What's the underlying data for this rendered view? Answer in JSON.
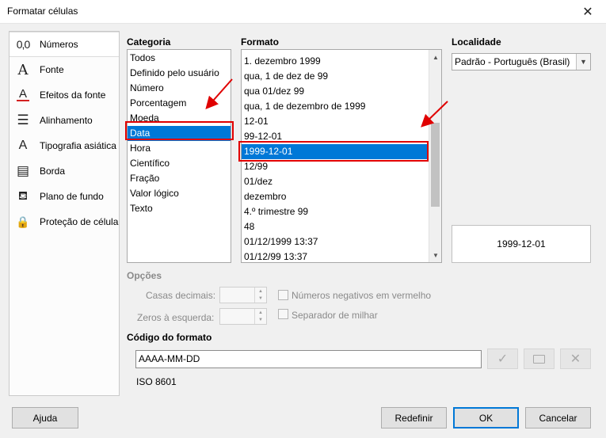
{
  "window": {
    "title": "Formatar células"
  },
  "sidebar": {
    "items": [
      {
        "label": "Números",
        "icon": "number-format-icon",
        "glyph": "0,0"
      },
      {
        "label": "Fonte",
        "icon": "font-icon",
        "glyph": "A"
      },
      {
        "label": "Efeitos da fonte",
        "icon": "font-effects-icon",
        "glyph": "A"
      },
      {
        "label": "Alinhamento",
        "icon": "alignment-icon",
        "glyph": "☰"
      },
      {
        "label": "Tipografia asiática",
        "icon": "asian-typography-icon",
        "glyph": "A"
      },
      {
        "label": "Borda",
        "icon": "border-icon",
        "glyph": "▤"
      },
      {
        "label": "Plano de fundo",
        "icon": "background-icon",
        "glyph": "⛾"
      },
      {
        "label": "Proteção de célula",
        "icon": "lock-icon",
        "glyph": "🔒"
      }
    ]
  },
  "category": {
    "label": "Categoria",
    "items": [
      "Todos",
      "Definido pelo usuário",
      "Número",
      "Porcentagem",
      "Moeda",
      "Data",
      "Hora",
      "Científico",
      "Fração",
      "Valor lógico",
      "Texto"
    ],
    "selected_index": 5
  },
  "format": {
    "label": "Formato",
    "items": [
      "1. dezembro 1999",
      "qua, 1 de dez de 99",
      "qua 01/dez 99",
      "qua, 1 de dezembro de 1999",
      "12-01",
      "99-12-01",
      "1999-12-01",
      "12/99",
      "01/dez",
      "dezembro",
      "4.º trimestre 99",
      "48",
      "01/12/1999 13:37",
      "01/12/99 13:37"
    ],
    "selected_index": 6
  },
  "locale": {
    "label": "Localidade",
    "value": "Padrão - Português (Brasil)"
  },
  "preview": {
    "text": "1999-12-01"
  },
  "options": {
    "label": "Opções",
    "decimal_places_label": "Casas decimais:",
    "leading_zeros_label": "Zeros à esquerda:",
    "negative_red_label": "Números negativos em vermelho",
    "thousands_sep_label": "Separador de milhar"
  },
  "format_code": {
    "label": "Código do formato",
    "value": "AAAA-MM-DD",
    "description": "ISO 8601"
  },
  "buttons": {
    "help": "Ajuda",
    "reset": "Redefinir",
    "ok": "OK",
    "cancel": "Cancelar"
  },
  "colors": {
    "selection": "#0078d7",
    "highlight": "#e00000"
  }
}
